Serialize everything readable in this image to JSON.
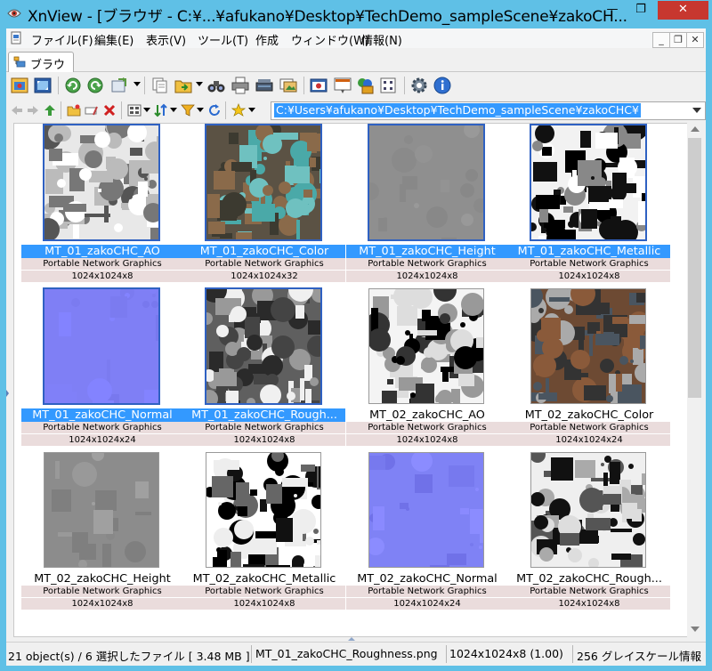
{
  "window": {
    "title": "XnView - [ブラウザ - C:¥...¥afukano¥Desktop¥TechDemo_sampleScene¥zakoCH...",
    "minimize_glyph": "—",
    "maximize_glyph": "❐",
    "close_glyph": "✕",
    "accent": "#5fc0e6"
  },
  "menu": {
    "items": [
      "ファイル(F)",
      "編集(E)",
      "表示(V)",
      "ツール(T)",
      "作成",
      "ウィンドウ(W)",
      "情報(N)"
    ],
    "mdi_minimize": "_",
    "mdi_restore": "❐",
    "mdi_close": "✕"
  },
  "tabs": [
    {
      "label": "ブラウザ"
    }
  ],
  "address": {
    "path": "C:¥Users¥afukano¥Desktop¥TechDemo_sampleScene¥zakoCHC¥"
  },
  "thumbnails": [
    {
      "name": "MT_01_zakoCHC_AO",
      "format": "Portable Network Graphics",
      "dims": "1024x1024x8",
      "selected": true,
      "kind": "ao"
    },
    {
      "name": "MT_01_zakoCHC_Color",
      "format": "Portable Network Graphics",
      "dims": "1024x1024x32",
      "selected": true,
      "kind": "color1"
    },
    {
      "name": "MT_01_zakoCHC_Height",
      "format": "Portable Network Graphics",
      "dims": "1024x1024x8",
      "selected": true,
      "kind": "height1"
    },
    {
      "name": "MT_01_zakoCHC_Metallic",
      "format": "Portable Network Graphics",
      "dims": "1024x1024x8",
      "selected": true,
      "kind": "metal1"
    },
    {
      "name": "MT_01_zakoCHC_Normal",
      "format": "Portable Network Graphics",
      "dims": "1024x1024x24",
      "selected": true,
      "kind": "normal"
    },
    {
      "name": "MT_01_zakoCHC_Rough...",
      "format": "Portable Network Graphics",
      "dims": "1024x1024x8",
      "selected": true,
      "kind": "rough1"
    },
    {
      "name": "MT_02_zakoCHC_AO",
      "format": "Portable Network Graphics",
      "dims": "1024x1024x8",
      "selected": false,
      "kind": "ao2"
    },
    {
      "name": "MT_02_zakoCHC_Color",
      "format": "Portable Network Graphics",
      "dims": "1024x1024x24",
      "selected": false,
      "kind": "color2"
    },
    {
      "name": "MT_02_zakoCHC_Height",
      "format": "Portable Network Graphics",
      "dims": "1024x1024x8",
      "selected": false,
      "kind": "height2"
    },
    {
      "name": "MT_02_zakoCHC_Metallic",
      "format": "Portable Network Graphics",
      "dims": "1024x1024x8",
      "selected": false,
      "kind": "metal2"
    },
    {
      "name": "MT_02_zakoCHC_Normal",
      "format": "Portable Network Graphics",
      "dims": "1024x1024x24",
      "selected": false,
      "kind": "normal2"
    },
    {
      "name": "MT_02_zakoCHC_Rough...",
      "format": "Portable Network Graphics",
      "dims": "1024x1024x8",
      "selected": false,
      "kind": "rough2"
    }
  ],
  "status": {
    "objects": "21 object(s) / 6 選択したファイル  [ 3.48 MB ]",
    "file": "MT_01_zakoCHC_Roughness.png",
    "info": "1024x1024x8 (1.00)",
    "color": "256 グレイスケール情報"
  },
  "icons": {
    "toolbar1": [
      "open-browser-icon",
      "fullscreen-icon",
      "rotate-left-icon",
      "rotate-right-icon",
      "convert-icon",
      "copy-icon",
      "move-icon",
      "binoculars-search-icon",
      "print-icon",
      "scanner-icon",
      "slideshow-icon",
      "capture-icon",
      "web-page-icon",
      "multi-window-icon",
      "contact-sheet-icon",
      "settings-gear-icon",
      "info-icon"
    ],
    "toolbar2": [
      "back-arrow-icon",
      "forward-arrow-icon",
      "up-folder-icon",
      "new-folder-icon",
      "rename-icon",
      "delete-icon",
      "view-mode-icon",
      "sort-icon",
      "filter-icon",
      "refresh-icon",
      "favorites-star-icon"
    ]
  }
}
